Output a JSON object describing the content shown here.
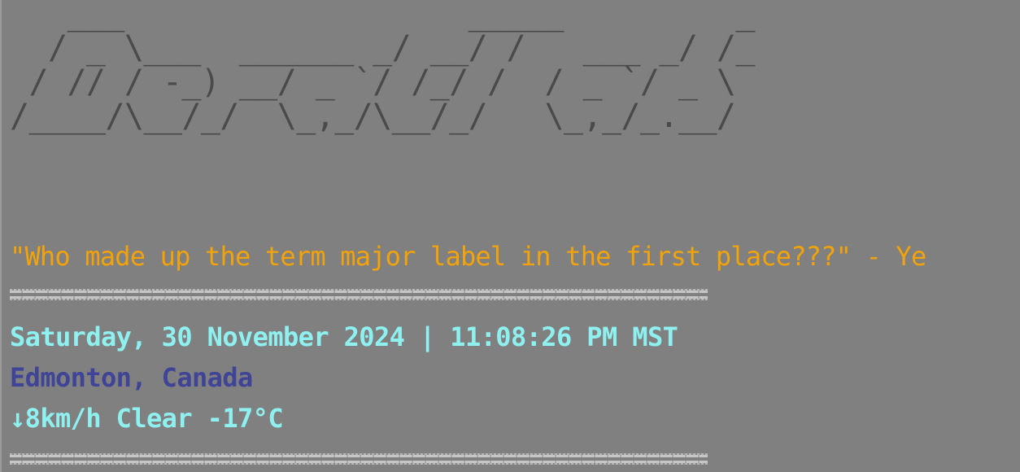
{
  "banner": {
    "ascii_art": "   ___                  _____         _\n  / _ \\___  ______ _/ __/ /   ___ _/ /_\n / // / -_) __/ _ `/ /_/ /  / _ `/ _ \\\n/____/\\__/_/  \\_,_/\\__/_/   \\_,_/_.__/"
  },
  "quote": {
    "text": "\"Who made up the term major label in the first place???\" - Ye"
  },
  "status": {
    "datetime": "Saturday, 30 November 2024 | 11:08:26 PM MST",
    "location": "Edmonton, Canada",
    "wind_arrow": "↓",
    "weather": "8km/h Clear -17°C"
  },
  "colors": {
    "background": "#808080",
    "banner": "#4a4a4a",
    "quote": "#f2a30a",
    "datetime": "#8ff0f0",
    "location": "#3f4496",
    "weather": "#8ff0f0"
  }
}
